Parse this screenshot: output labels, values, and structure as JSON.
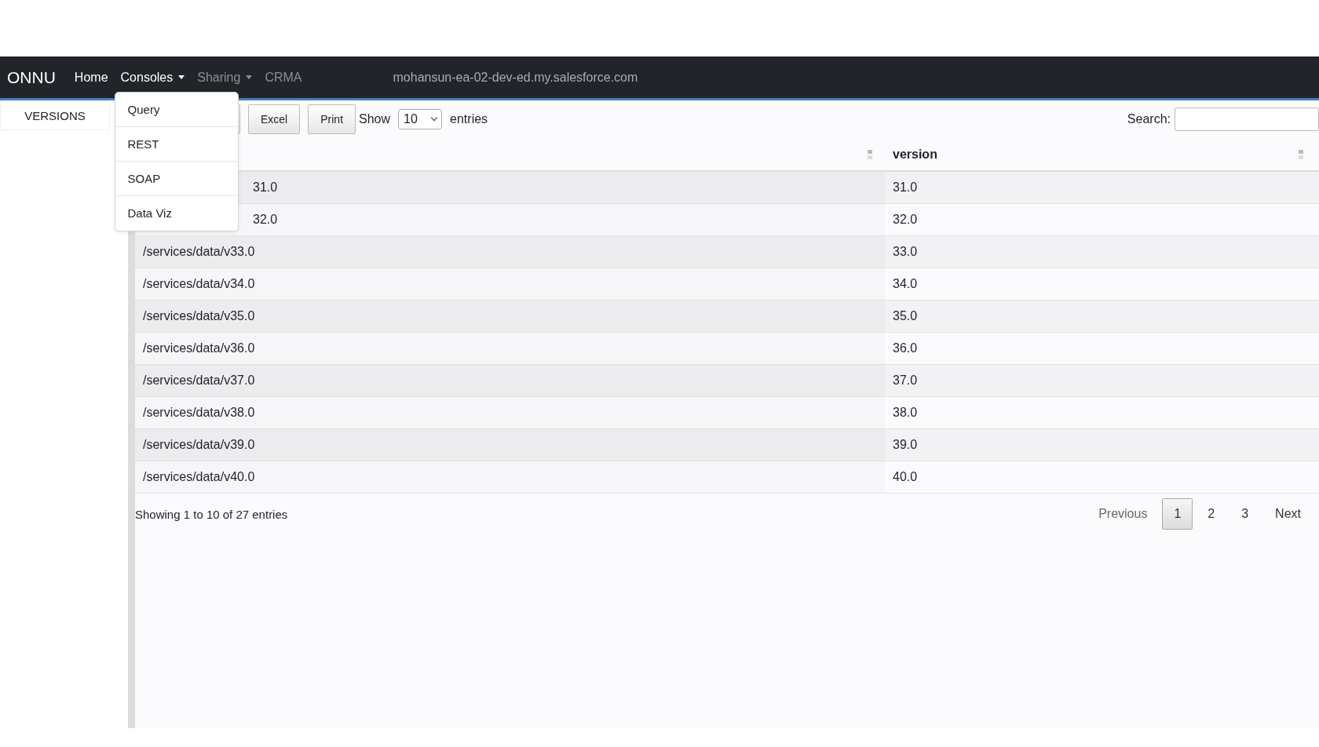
{
  "navbar": {
    "brand": "ONNU",
    "items": [
      {
        "label": "Home",
        "kind": "link",
        "disabled": false
      },
      {
        "label": "Consoles",
        "kind": "dropdown",
        "disabled": false,
        "menu": [
          "Query",
          "REST",
          "SOAP",
          "Data Viz"
        ]
      },
      {
        "label": "Sharing",
        "kind": "dropdown",
        "disabled": true
      },
      {
        "label": "CRMA",
        "kind": "link",
        "disabled": true
      }
    ],
    "host": "mohansun-ea-02-dev-ed.my.salesforce.com"
  },
  "sidebar": {
    "tabs": [
      {
        "label": "VERSIONS",
        "selected": true
      }
    ]
  },
  "toolbar": {
    "buttons": [
      "Excel",
      "Print"
    ],
    "show_label": "Show",
    "page_size": "10",
    "entries_label": "entries",
    "search_label": "Search:"
  },
  "table": {
    "columns": [
      "",
      "version"
    ],
    "rows": [
      {
        "cells": [
          "31.0",
          "31.0"
        ],
        "partly_hidden": true
      },
      {
        "cells": [
          "32.0",
          "32.0"
        ],
        "partly_hidden": true
      },
      {
        "cells": [
          "/services/data/v33.0",
          "33.0"
        ],
        "partly_hidden": false
      },
      {
        "cells": [
          "/services/data/v34.0",
          "34.0"
        ],
        "partly_hidden": false
      },
      {
        "cells": [
          "/services/data/v35.0",
          "35.0"
        ],
        "partly_hidden": false
      },
      {
        "cells": [
          "/services/data/v36.0",
          "36.0"
        ],
        "partly_hidden": false
      },
      {
        "cells": [
          "/services/data/v37.0",
          "37.0"
        ],
        "partly_hidden": false
      },
      {
        "cells": [
          "/services/data/v38.0",
          "38.0"
        ],
        "partly_hidden": false
      },
      {
        "cells": [
          "/services/data/v39.0",
          "39.0"
        ],
        "partly_hidden": false
      },
      {
        "cells": [
          "/services/data/v40.0",
          "40.0"
        ],
        "partly_hidden": false
      }
    ]
  },
  "footer": {
    "info": "Showing 1 to 10 of 27 entries",
    "pagination": [
      {
        "label": "Previous",
        "selected": false
      },
      {
        "label": "1",
        "selected": true
      },
      {
        "label": "2",
        "selected": false
      },
      {
        "label": "3",
        "selected": false
      },
      {
        "label": "Next",
        "selected": false
      }
    ]
  }
}
